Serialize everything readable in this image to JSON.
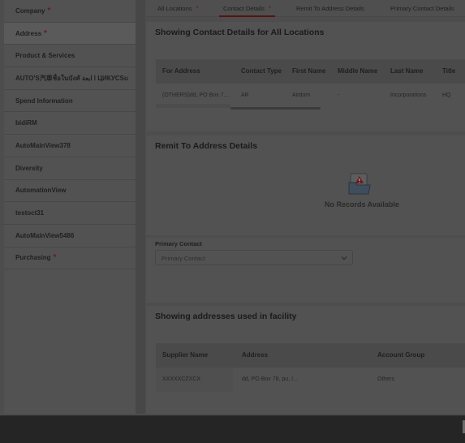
{
  "sidebar": {
    "items": [
      {
        "label": "Company",
        "required": true
      },
      {
        "label": "Address",
        "required": true
      },
      {
        "label": "Product & Services",
        "required": false
      },
      {
        "label": "AUTO'S汽車ชื่อในบังคั ا ابعة ЦИКУСSu",
        "required": false
      },
      {
        "label": "Spend Information",
        "required": false
      },
      {
        "label": "bidiRM",
        "required": false
      },
      {
        "label": "AutoMainView378",
        "required": false
      },
      {
        "label": "Diversity",
        "required": false
      },
      {
        "label": "AutomationView",
        "required": false
      },
      {
        "label": "testoct31",
        "required": false
      },
      {
        "label": "AutoMainView5486",
        "required": false
      },
      {
        "label": "Purchasing",
        "required": true
      }
    ],
    "required_mark": "*"
  },
  "tabs": [
    {
      "label": "All Locations",
      "required": true
    },
    {
      "label": "Contact Details",
      "required": true
    },
    {
      "label": "Remit To Address Details",
      "required": false
    },
    {
      "label": "Primary Contact Details",
      "required": false
    }
  ],
  "contact_details": {
    "title": "Showing Contact Details for All Locations",
    "columns": [
      "For Address",
      "Contact Type",
      "First Name",
      "Middle Name",
      "Last Name",
      "Title"
    ],
    "rows": [
      [
        "(OTHERS)dd, PO Box 7...",
        "AR",
        "Airdom",
        "-",
        "Incorporations",
        "HQ"
      ]
    ]
  },
  "remit_to": {
    "title": "Remit To Address Details",
    "empty_message": "No Records Available",
    "icon": "empty-folder-warning-icon"
  },
  "primary_contact": {
    "label": "Primary Contact",
    "placeholder": "Primary Contact",
    "icon": "chevron-down-icon"
  },
  "facility_addresses": {
    "title": "Showing addresses used in facility",
    "columns": [
      "Supplier Name",
      "Address",
      "Account Group"
    ],
    "rows": [
      [
        "XXXXXCZXCX",
        "dd, PO Box 78, pu, I...",
        "Others"
      ]
    ]
  },
  "colors": {
    "required": "#6b1a1a",
    "overlay_text": "#1e1e1e"
  }
}
